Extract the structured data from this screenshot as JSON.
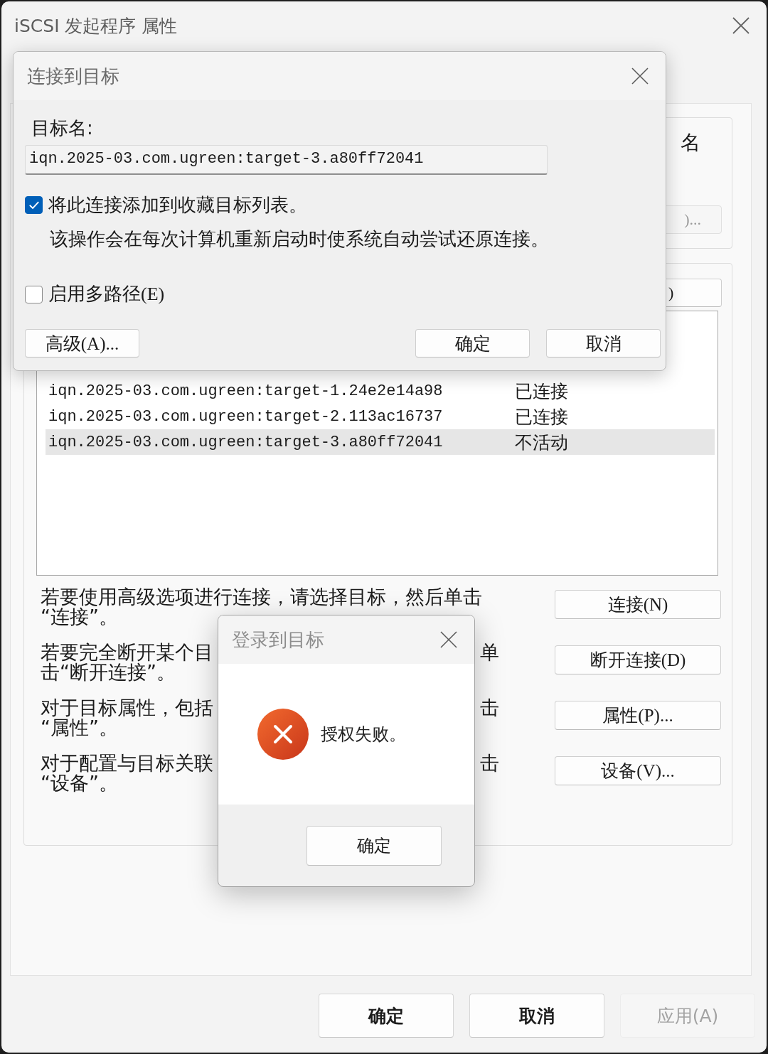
{
  "window": {
    "title": "iSCSI 发起程序 属性",
    "buttons": [
      {
        "label": "确定",
        "disabled": false
      },
      {
        "label": "取消",
        "disabled": false
      },
      {
        "label": "应用(A)",
        "disabled": true
      }
    ]
  },
  "quick_connect": {
    "label_fragment": "名",
    "button_fragment": ")..."
  },
  "targets": {
    "refresh_button_fragment": ")",
    "rows": [
      {
        "name": "iqn.2025-03.com.ugreen:target-1.24e2e14a98",
        "status": "已连接",
        "selected": false
      },
      {
        "name": "iqn.2025-03.com.ugreen:target-2.113ac16737",
        "status": "已连接",
        "selected": false
      },
      {
        "name": "iqn.2025-03.com.ugreen:target-3.a80ff72041",
        "status": "不活动",
        "selected": true
      }
    ],
    "instructions": [
      {
        "kind": "whole",
        "lines": [
          "若要使用高级选项进行连接，请选择目标，然后单击",
          "“连接”。"
        ],
        "button": "连接(N)"
      },
      {
        "kind": "covered",
        "line_1_start": "若要完全断开某个目",
        "line_1_end": "单",
        "line_2": "击“断开连接”。",
        "button": "断开连接(D)"
      },
      {
        "kind": "covered",
        "line_1_start": "对于目标属性，包括",
        "line_1_end": "击",
        "line_2": "“属性”。",
        "button": "属性(P)..."
      },
      {
        "kind": "covered",
        "line_1_start": "对于配置与目标关联",
        "line_1_end": "击",
        "line_2": "“设备”。",
        "button": "设备(V)..."
      }
    ]
  },
  "connect_dialog": {
    "title": "连接到目标",
    "target_label": "目标名:",
    "target_value": "iqn.2025-03.com.ugreen:target-3.a80ff72041",
    "options": [
      {
        "label": "将此连接添加到收藏目标列表。",
        "checked": true,
        "description": "该操作会在每次计算机重新启动时使系统自动尝试还原连接。"
      },
      {
        "label": "启用多路径(E)",
        "checked": false
      }
    ],
    "buttons": [
      "高级(A)...",
      "确定",
      "取消"
    ]
  },
  "login_dialog": {
    "title": "登录到目标",
    "message": "授权失败。",
    "button": "确定"
  }
}
